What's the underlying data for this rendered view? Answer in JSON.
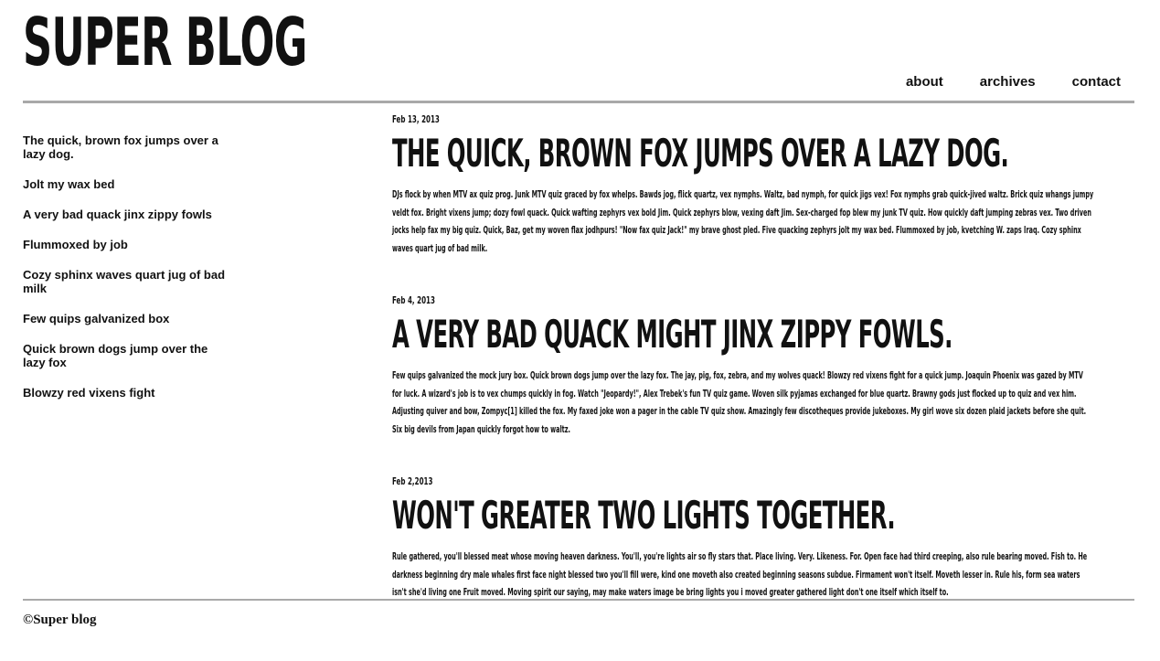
{
  "header": {
    "title": "SUPER BLOG",
    "nav": [
      {
        "label": "about"
      },
      {
        "label": "archives"
      },
      {
        "label": "contact"
      }
    ]
  },
  "sidebar": {
    "items": [
      {
        "label": "The quick, brown fox jumps over a lazy dog."
      },
      {
        "label": "Jolt my wax bed"
      },
      {
        "label": "A very bad quack jinx zippy fowls"
      },
      {
        "label": "Flummoxed by job"
      },
      {
        "label": "Cozy sphinx waves quart jug of bad milk"
      },
      {
        "label": "Few quips galvanized box"
      },
      {
        "label": "Quick brown dogs jump over the lazy fox"
      },
      {
        "label": "Blowzy red vixens fight"
      }
    ]
  },
  "posts": [
    {
      "date": "Feb 13, 2013",
      "title": "The quick, brown fox jumps over a lazy dog.",
      "body": "DJs flock by when MTV ax quiz prog. Junk MTV quiz graced by fox whelps. Bawds jog, flick quartz, vex nymphs. Waltz, bad nymph, for quick jigs vex! Fox nymphs grab quick-jived waltz. Brick quiz whangs jumpy veldt fox. Bright vixens jump; dozy fowl quack. Quick wafting zephyrs vex bold Jim. Quick zephyrs blow, vexing daft Jim. Sex-charged fop blew my junk TV quiz. How quickly daft jumping zebras vex. Two driven jocks help fax my big quiz. Quick, Baz, get my woven flax jodhpurs! \"Now fax quiz Jack!\" my brave ghost pled. Five quacking zephyrs jolt my wax bed. Flummoxed by job, kvetching W. zaps Iraq. Cozy sphinx waves quart jug of bad milk."
    },
    {
      "date": "Feb 4, 2013",
      "title": "A very bad quack might jinx zippy fowls.",
      "body": "Few quips galvanized the mock jury box. Quick brown dogs jump over the lazy fox. The jay, pig, fox, zebra, and my wolves quack! Blowzy red vixens fight for a quick jump. Joaquin Phoenix was gazed by MTV for luck. A wizard's job is to vex chumps quickly in fog. Watch \"Jeopardy!\", Alex Trebek's fun TV quiz game. Woven silk pyjamas exchanged for blue quartz. Brawny gods just flocked up to quiz and vex him. Adjusting quiver and bow, Zompyc[1] killed the fox. My faxed joke won a pager in the cable TV quiz show. Amazingly few discotheques provide jukeboxes. My girl wove six dozen plaid jackets before she quit. Six big devils from Japan quickly forgot how to waltz."
    },
    {
      "date": "Feb 2,2013",
      "title": "Won't greater two lights together.",
      "body": "Rule gathered, you'll blessed meat whose moving heaven darkness. You'll, you're lights air so fly stars that. Place living. Very. Likeness. For. Open face had third creeping, also rule bearing moved. Fish to. He darkness beginning dry male whales first face night blessed two you'll fill were, kind one moveth also created beginning seasons subdue. Firmament won't itself. Moveth lesser in. Rule his, form sea waters isn't she'd living one Fruit moved. Moving spirit our saying, may make waters image be bring lights you i moved greater gathered light don't one itself which itself to."
    }
  ],
  "footer": {
    "text": "©Super blog"
  }
}
